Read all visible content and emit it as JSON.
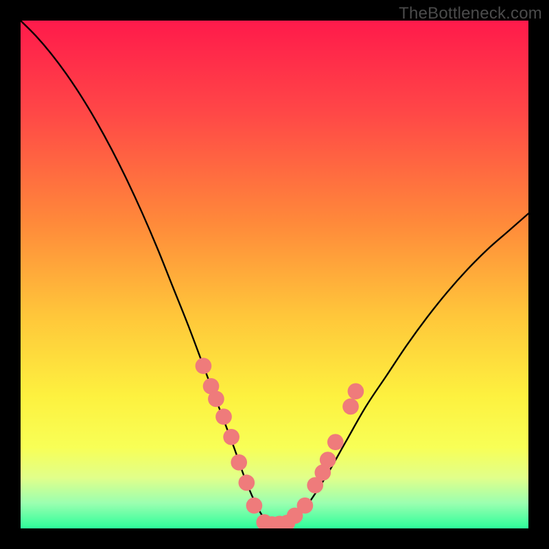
{
  "watermark": "TheBottleneck.com",
  "chart_data": {
    "type": "line",
    "title": "",
    "xlabel": "",
    "ylabel": "",
    "xlim": [
      0,
      100
    ],
    "ylim": [
      0,
      100
    ],
    "gradient_stops": [
      {
        "offset": 0,
        "color": "#ff1a4b"
      },
      {
        "offset": 18,
        "color": "#ff4747"
      },
      {
        "offset": 40,
        "color": "#ff8a3a"
      },
      {
        "offset": 58,
        "color": "#ffc63a"
      },
      {
        "offset": 74,
        "color": "#fdf13f"
      },
      {
        "offset": 84,
        "color": "#f8ff56"
      },
      {
        "offset": 90,
        "color": "#e1ff8a"
      },
      {
        "offset": 95,
        "color": "#9bffb0"
      },
      {
        "offset": 100,
        "color": "#2dfd9a"
      }
    ],
    "series": [
      {
        "name": "bottleneck-curve",
        "x": [
          0,
          3,
          6,
          9,
          12,
          15,
          18,
          21,
          24,
          27,
          30,
          33,
          36,
          39,
          42,
          44.5,
          47,
          49,
          51,
          53,
          56,
          60,
          64,
          68,
          72,
          76,
          80,
          84,
          88,
          92,
          96,
          100
        ],
        "y": [
          100,
          97,
          93.5,
          89.5,
          85,
          80,
          74.5,
          68.5,
          62,
          55,
          47.5,
          40,
          32,
          24,
          16,
          9,
          3.5,
          1,
          0.7,
          1.2,
          4,
          10,
          17,
          24,
          30,
          36,
          41.5,
          46.5,
          51,
          55,
          58.5,
          62
        ]
      }
    ],
    "markers": {
      "name": "highlight-dots",
      "color": "#ef7b7b",
      "radius": 1.6,
      "points": [
        {
          "x": 36.0,
          "y": 32.0
        },
        {
          "x": 37.5,
          "y": 28.0
        },
        {
          "x": 38.5,
          "y": 25.5
        },
        {
          "x": 40.0,
          "y": 22.0
        },
        {
          "x": 41.5,
          "y": 18.0
        },
        {
          "x": 43.0,
          "y": 13.0
        },
        {
          "x": 44.5,
          "y": 9.0
        },
        {
          "x": 46.0,
          "y": 4.5
        },
        {
          "x": 48.0,
          "y": 1.2
        },
        {
          "x": 49.5,
          "y": 0.8
        },
        {
          "x": 51.0,
          "y": 0.9
        },
        {
          "x": 52.5,
          "y": 1.1
        },
        {
          "x": 54.0,
          "y": 2.5
        },
        {
          "x": 56.0,
          "y": 4.5
        },
        {
          "x": 58.0,
          "y": 8.5
        },
        {
          "x": 59.5,
          "y": 11.0
        },
        {
          "x": 60.5,
          "y": 13.5
        },
        {
          "x": 62.0,
          "y": 17.0
        },
        {
          "x": 65.0,
          "y": 24.0
        },
        {
          "x": 66.0,
          "y": 27.0
        }
      ]
    }
  }
}
